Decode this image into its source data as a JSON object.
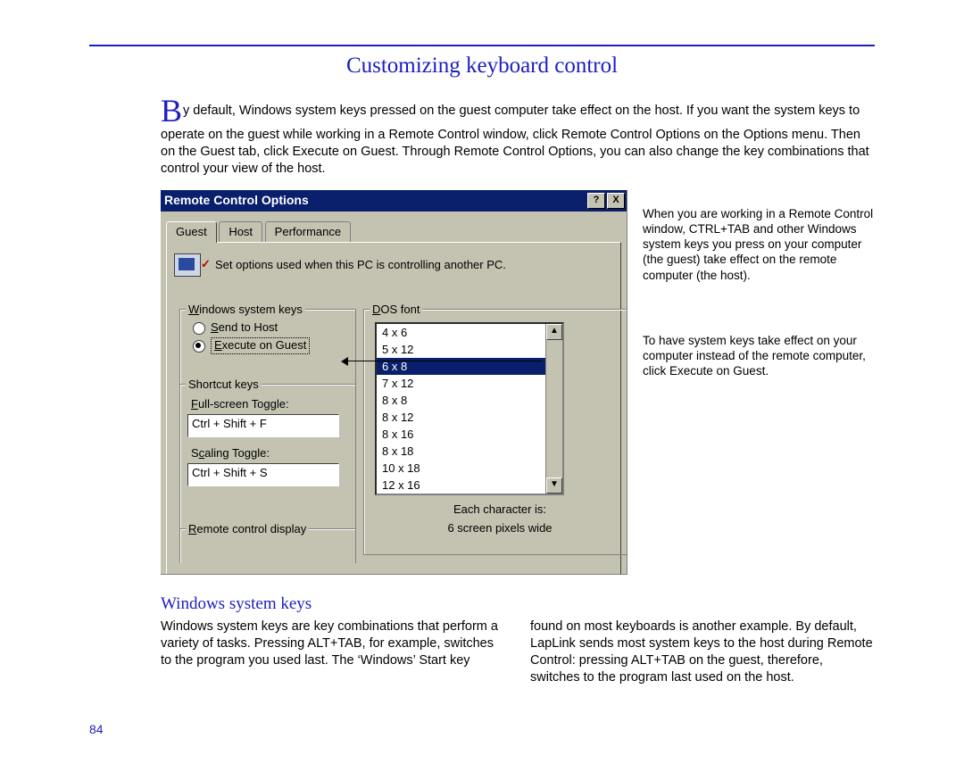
{
  "page_title": "Customizing keyboard control",
  "intro_dropcap": "B",
  "intro_text": "y default, Windows system keys pressed on the guest computer take effect on the host. If you want the system keys to operate on the guest while working in a Remote Control window, click Remote Control Options on the Options menu. Then on the Guest tab, click Execute on Guest. Through Remote Control Options, you can also change the key combinations that control your view of the host.",
  "dialog": {
    "title": "Remote Control Options",
    "help_btn": "?",
    "close_btn": "X",
    "tabs": {
      "guest": "Guest",
      "host": "Host",
      "performance": "Performance"
    },
    "desc": "Set options used when this PC is controlling another PC.",
    "syskeys": {
      "label": "Windows system keys",
      "opt_host": "Send to Host",
      "opt_guest": "Execute on Guest"
    },
    "shortcut": {
      "label": "Shortcut keys",
      "fs_label": "Full-screen Toggle:",
      "fs_value": "Ctrl + Shift + F",
      "sc_label": "Scaling Toggle:",
      "sc_value": "Ctrl + Shift + S"
    },
    "remote_display_label": "Remote control display",
    "dos": {
      "label": "DOS font",
      "items": [
        "4 x 6",
        "5 x 12",
        "6 x 8",
        "7 x 12",
        "8 x  8",
        "8 x 12",
        "8 x 16",
        "8 x 18",
        "10 x 18",
        "12 x 16"
      ],
      "selected_index": 2,
      "footer1": "Each character is:",
      "footer2": "6   screen pixels wide"
    }
  },
  "annotation1": "When you are working in a Remote Control window, CTRL+TAB and other Windows system keys you press on your computer (the guest) take effect on the remote computer (the host).",
  "annotation2": "To have system keys take effect on your computer instead of the remote computer, click Execute on Guest.",
  "subhead": "Windows system keys",
  "col1": "Windows system keys are key combinations that perform a variety of tasks. Pressing ALT+TAB, for example, switches to the program you used last. The ‘Windows’ Start key",
  "col2": "found on most keyboards is another example. By default, LapLink sends most system keys to the host during Remote Control: pressing ALT+TAB on the guest, therefore, switches to the program last used on the host.",
  "page_number": "84"
}
